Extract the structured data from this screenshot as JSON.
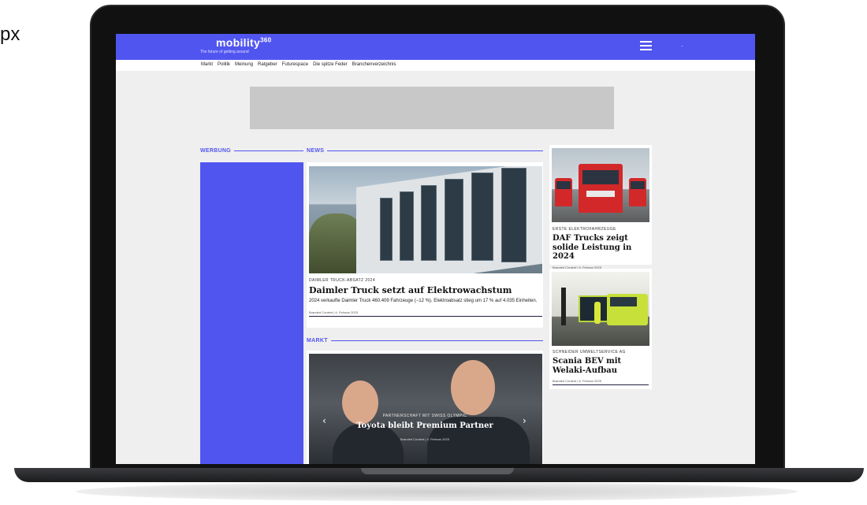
{
  "outside": {
    "label": "px"
  },
  "site": {
    "logo": "mobility",
    "logo_sup": "360",
    "tagline": "The future of getting around",
    "menu_icon": "hamburger-menu-icon",
    "brand_color": "#5155f0"
  },
  "nav": {
    "items": [
      "Markt",
      "Politik",
      "Meinung",
      "Ratgeber",
      "Futurespace",
      "Die spitze Feder",
      "Branchenverzeichnis"
    ]
  },
  "sections": {
    "werbung": "WERBUNG",
    "news": "NEWS",
    "markt": "MARKT"
  },
  "articles": {
    "main": {
      "kicker": "DAIMLER TRUCK-ABSATZ 2024",
      "headline": "Daimler Truck setzt auf Elektrowachstum",
      "teaser": "2024 verkaufte Daimler Truck 460.409 Fahrzeuge (−12 %). Elektroabsatz stieg um 17 % auf 4.035 Einheiten.",
      "meta": "Branded Content  |  6. Februar 2025"
    },
    "daf": {
      "kicker": "ERSTE ELEKTROFAHRZEUGE",
      "headline": "DAF Trucks zeigt solide Leistung in 2024",
      "meta": "Branded Content  |  6. Februar 2025"
    },
    "scania": {
      "kicker": "SCHNEIDER UMWELTSERVICE AG",
      "headline": "Scania BEV mit Welaki-Aufbau",
      "meta": "Branded Content  |  6. Februar 2025"
    },
    "markt_slide": {
      "kicker": "PARTNERSCHAFT MIT SWISS OLYMPIC",
      "headline": "Toyota bleibt Premium Partner",
      "meta": "Branded Content  |  4. Februar 2025",
      "prev": "‹",
      "next": "›"
    }
  }
}
